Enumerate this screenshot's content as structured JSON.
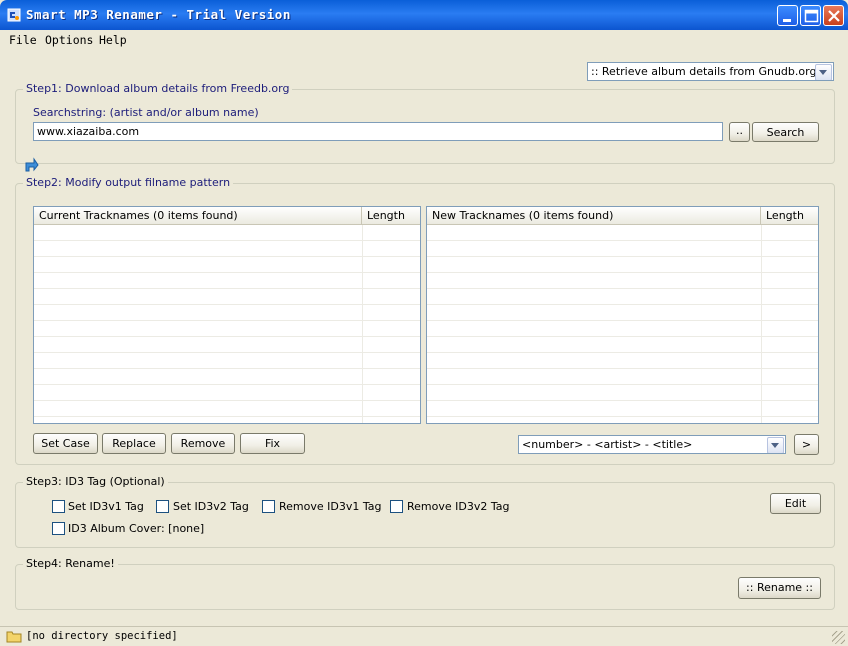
{
  "window": {
    "title": "Smart MP3 Renamer - Trial Version",
    "controls": [
      "minimize",
      "maximize",
      "close"
    ]
  },
  "menu": {
    "items": [
      "File",
      "Options",
      "Help"
    ]
  },
  "source_select": {
    "value": ":: Retrieve album details from Gnudb.org ::"
  },
  "step1": {
    "title": "Step1: Download album details from Freedb.org",
    "search_label": "Searchstring: (artist and/or album name)",
    "search_value": "www.xiazaiba.com",
    "browse_label": "..",
    "search_button": "Search"
  },
  "step2": {
    "title": "Step2: Modify output filname pattern",
    "current_list": {
      "columns": [
        "Current Tracknames (0 items found)",
        "Length"
      ]
    },
    "new_list": {
      "columns": [
        "New Tracknames (0 items found)",
        "Length"
      ]
    },
    "buttons": [
      "Set Case",
      "Replace",
      "Remove",
      "Fix"
    ],
    "pattern_value": "<number> - <artist> - <title>",
    "apply_label": ">"
  },
  "step3": {
    "title": "Step3: ID3 Tag (Optional)",
    "options": [
      {
        "label": "Set ID3v1 Tag",
        "checked": false
      },
      {
        "label": "Set ID3v2 Tag",
        "checked": false
      },
      {
        "label": "Remove ID3v1 Tag",
        "checked": false
      },
      {
        "label": "Remove ID3v2 Tag",
        "checked": false
      },
      {
        "label": "ID3 Album Cover: [none]",
        "checked": false
      }
    ],
    "edit_button": "Edit"
  },
  "step4": {
    "title": "Step4: Rename!",
    "rename_button": ":: Rename ::"
  },
  "statusbar": {
    "text": "[no directory specified]"
  },
  "colors": {
    "title_bar": "#0a5fd8",
    "window_bg": "#ece9d8",
    "group_title": "#1c1c7a",
    "input_border": "#7f9db9"
  },
  "icons": [
    "app-icon",
    "minimize-icon",
    "maximize-icon",
    "close-icon",
    "dropdown-arrow-icon",
    "collapse-arrow-icon",
    "folder-icon"
  ]
}
